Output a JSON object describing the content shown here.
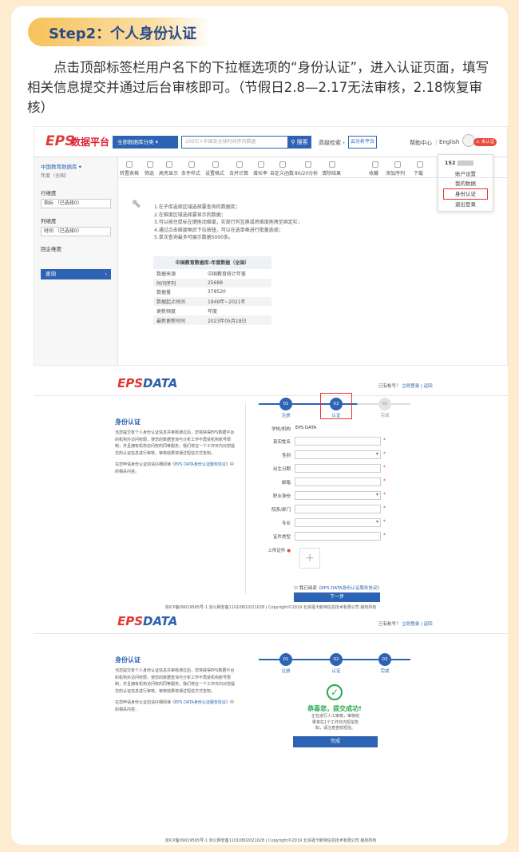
{
  "header": {
    "step": "Step2：个人身份认证"
  },
  "intro": "点击顶部标签栏用户名下的下拉框选项的“身份认证”，进入认证页面，填写相关信息提交并通过后台审核即可。（节假日2.8—2.17无法审核，2.18恢复审核）",
  "s1": {
    "logo": "EPS",
    "brand": "数据平台",
    "category": "全部数据库分类",
    "search_ph": "100亿+中国及全球时间序列数据",
    "search_btn": "搜索",
    "adv": "高级检索",
    "yun": "云分析平台",
    "help": "帮助中心",
    "lang": "English",
    "badge": "未认证",
    "menu": {
      "user": "152",
      "items": [
        "账户设置",
        "我的数据",
        "身份认证",
        "退出登录"
      ]
    },
    "side": {
      "db": "中国教育数据库",
      "sub": "年度（全国）",
      "row_lbl": "行维度",
      "row_sel": "指标 （已选择0）",
      "col_lbl": "列维度",
      "col_sel": "时间 （已选择0）",
      "back": "回企维度",
      "query": "查询"
    },
    "tools": [
      "转置表格",
      "筛选",
      "高亮显示",
      "条件样式",
      "设置格式",
      "合并计算",
      "增长率",
      "自定义函数",
      "80/20分析",
      "清除结果",
      "收藏",
      "添加序列",
      "下载"
    ],
    "steps": [
      "1.在子库选择区域选择要查询的数据库；",
      "2.在维度区域选择要显示的数据；",
      "3.可以按住鼠标左键拖动维度，实现行列互换或将维度拖拽至固定栏；",
      "4.通过点击维度框后下拉按钮，可以在选单框进行批量选择；",
      "5.单次查询最多可展示数据5000条。"
    ],
    "table": {
      "title": "中国教育数据库-年度数据（全国）",
      "rows": [
        [
          "数据来源",
          "中国教育统计年鉴"
        ],
        [
          "时间序列",
          "25688"
        ],
        [
          "数据量",
          "378520"
        ],
        [
          "数据起止时间",
          "1949年~2021年"
        ],
        [
          "更新频度",
          "年度"
        ],
        [
          "最新更新时间",
          "2023年05月18日"
        ]
      ]
    }
  },
  "s2": {
    "logo_a": "EPS",
    "logo_b": "DATA",
    "acct": "已有帐号？",
    "login": "立即登录",
    "sep": "|",
    "ret": "返回",
    "title": "身份认证",
    "desc": "当您提交有个人身份认证信息并审核通过后，您将获得EPS数据平台的机构外访问权限，使您的数据查询与分析工作不再受机构账号限制，并且拥有机构访问权的同等服务。我们将在一个工作日内对您提交的认证信息进行审核，审核结果将通过短信方式告知。",
    "link_pre": "在您申请身份认证前请仔细阅读",
    "link": "《EPS DATA身份认证服务协议》",
    "link_post": "中的相关内容。",
    "steps": [
      {
        "n": "01",
        "l": "注册"
      },
      {
        "n": "02",
        "l": "认证"
      },
      {
        "n": "03",
        "l": "完成"
      }
    ],
    "org_lbl": "学校/机构",
    "org": "EPS DATA",
    "fields": [
      "真实姓名",
      "性别",
      "出生日期",
      "邮箱",
      "职业身份",
      "院系/部门",
      "专业",
      "证件类型"
    ],
    "upload": "上传证件",
    "plus": "+",
    "agree": "我已阅读",
    "agree_link": "《EPS DATA身份认证服务协议》",
    "next": "下一步",
    "foot": "京ICP备09019565号-1 京公网安备11010802021028  |  Copyright©2019 北京福卡斯特信息技术有限公司 版权所有"
  },
  "s3": {
    "ok_title": "恭喜您，提交成功!",
    "ok_desc": "正在进行人工审核，审核结果将在1个工作日内短信告知，请注意查收短信。",
    "done": "完成",
    "check": "✓"
  }
}
